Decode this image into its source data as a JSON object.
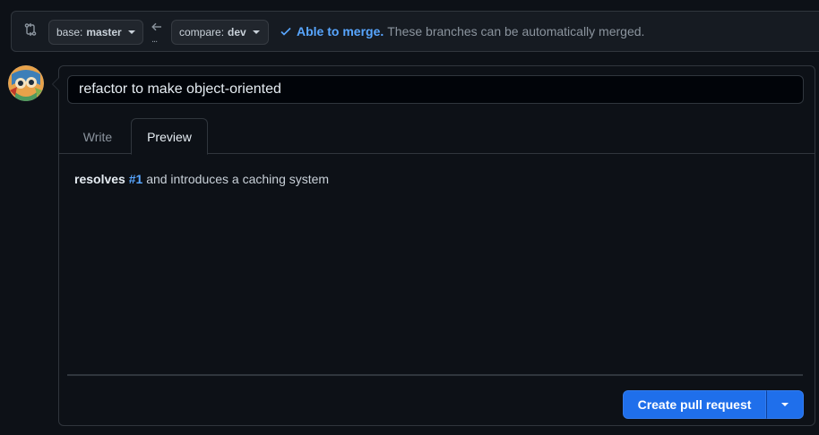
{
  "range": {
    "base_label": "base:",
    "base_value": "master",
    "compare_label": "compare:",
    "compare_value": "dev",
    "ellipsis": "...",
    "merge_title": "Able to merge.",
    "merge_description": "These branches can be automatically merged."
  },
  "composer": {
    "title_value": "refactor to make object-oriented",
    "tabs": [
      {
        "label": "Write"
      },
      {
        "label": "Preview"
      }
    ],
    "active_tab": "Preview",
    "preview": {
      "bold_word": "resolves",
      "issue_link": "#1",
      "rest": "and introduces a caching system"
    },
    "create_button_label": "Create pull request"
  },
  "icons": {
    "compare": "git-compare-icon",
    "arrow": "arrow-left-icon",
    "check": "check-icon",
    "caret": "triangle-down-icon"
  },
  "colors": {
    "accent": "#58a6ff",
    "primary_button": "#1f6feb",
    "background": "#0d1117"
  }
}
